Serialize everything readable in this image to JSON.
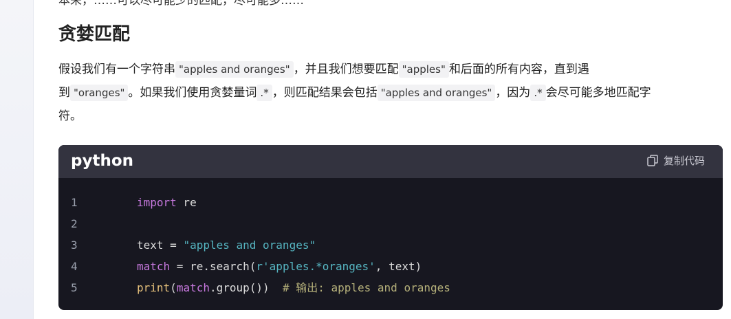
{
  "previous_text": "本来，……可以尽可能少的匹配，尽可能多……",
  "section": {
    "title": "贪婪匹配"
  },
  "paragraph": {
    "line1": {
      "t1": "假设我们有一个字符串",
      "c1": "\"apples and oranges\"",
      "t2": "，并且我们想要匹配",
      "c2": "\"apples\"",
      "t3": "和后面的所有内容，直到遇"
    },
    "line2": {
      "t1": "到",
      "c1": "\"oranges\"",
      "t2": "。如果我们使用贪婪量词",
      "c2": ".*",
      "t3": "，则匹配结果会包括",
      "c3": "\"apples and oranges\"",
      "t4": "，因为",
      "c4": ".*",
      "t5": "会尽可能多地匹配字"
    },
    "line3": "符。"
  },
  "code_block": {
    "language": "python",
    "copy_label": "复制代码",
    "lines": [
      {
        "n": "1",
        "tokens": [
          [
            "kw",
            "import"
          ],
          [
            "",
            " re"
          ]
        ]
      },
      {
        "n": "2",
        "tokens": []
      },
      {
        "n": "3",
        "tokens": [
          [
            "",
            "text = "
          ],
          [
            "str",
            "\"apples and oranges\""
          ]
        ]
      },
      {
        "n": "4",
        "tokens": [
          [
            "kw",
            "match"
          ],
          [
            "",
            " = re.search("
          ],
          [
            "str",
            "r'apples.*oranges'"
          ],
          [
            "",
            ", text)"
          ]
        ]
      },
      {
        "n": "5",
        "tokens": [
          [
            "fn",
            "print"
          ],
          [
            "",
            "("
          ],
          [
            "kw",
            "match"
          ],
          [
            "",
            ".group())  "
          ],
          [
            "cm",
            "# 输出: apples and oranges"
          ]
        ]
      }
    ]
  },
  "colors": {
    "code_bg": "#171720",
    "code_header_bg": "#33333f",
    "keyword": "#c678dd",
    "string": "#56b6c2",
    "builtin": "#e5c07b",
    "comment": "#b5b07a"
  },
  "icons": {
    "copy": "copy-icon"
  }
}
